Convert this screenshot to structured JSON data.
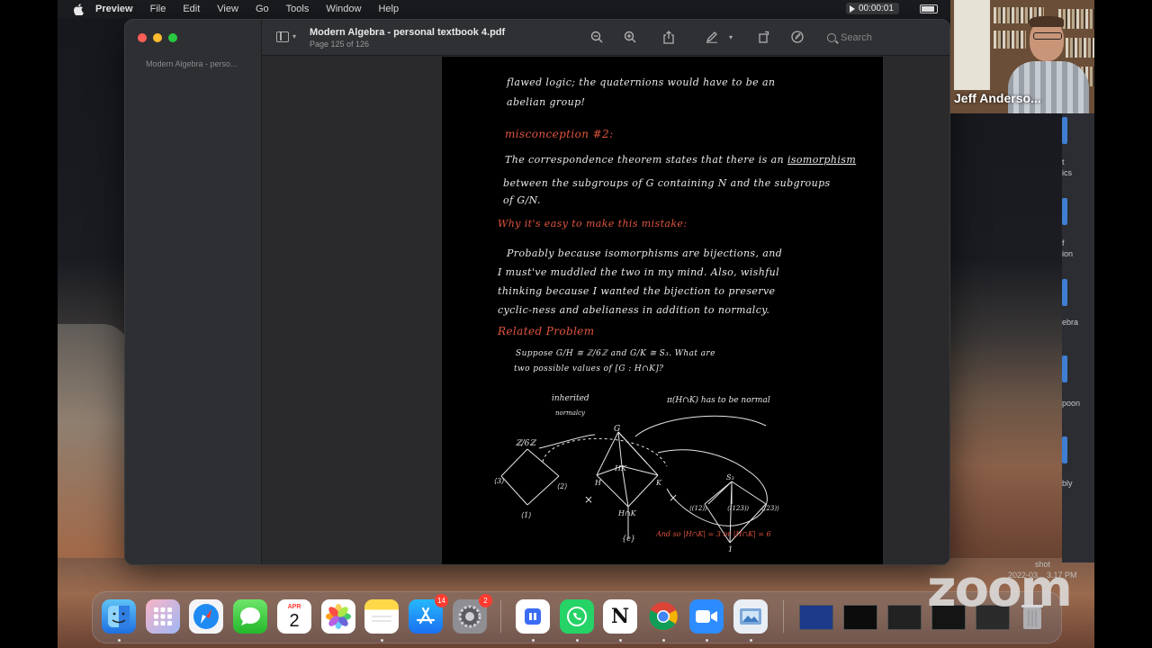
{
  "menubar": {
    "app": "Preview",
    "items": [
      "File",
      "Edit",
      "View",
      "Go",
      "Tools",
      "Window",
      "Help"
    ],
    "recording_time": "00:00:01"
  },
  "window": {
    "title": "Modern Algebra - personal textbook 4.pdf",
    "subtitle": "Page 125 of 126",
    "sidebar_thumb_title": "Modern Algebra - perso...",
    "search_placeholder": "Search"
  },
  "notes": {
    "line1": "flawed logic; the quaternions would have to be an",
    "line2": "abelian group!",
    "heading1": "misconception #2:",
    "p1a": "The correspondence theorem states that there is an",
    "p1b": "isomorphism",
    "p1c": "between the subgroups of G containing N and the subgroups",
    "p1d": "of G/N.",
    "heading2": "Why it's easy to make this mistake:",
    "p2a": "Probably because isomorphisms are bijections, and",
    "p2b": "I must've muddled the two in my mind. Also, wishful",
    "p2c": "thinking because I wanted the bijection to preserve",
    "p2d": "cyclic-ness and abelianess in addition to normalcy.",
    "heading3": "Related Problem",
    "prob1": "Suppose G/H ≅ ℤ/6ℤ and G/K ≅ S₃. What are",
    "prob2": "two possible values of [G : H∩K]?",
    "diagram": {
      "inherited": "inherited",
      "normalcy": "normalcy",
      "pi_note": "π(H∩K) has to be normal",
      "z6": "ℤ/6ℤ",
      "n3": "⟨3⟩",
      "n2": "⟨2⟩",
      "n1": "⟨1⟩",
      "g": "G",
      "h": "H",
      "k": "K",
      "hk": "HK",
      "hnk": "H∩K",
      "e": "{e}",
      "s3": "S₃",
      "s12": "⟨(12)⟩",
      "s123": "⟨(123)⟩",
      "s23": "⟨(23)⟩",
      "one": "1",
      "x": "×",
      "answer": "And so |H∩K| = 3 or |H∩K| = 6"
    }
  },
  "zoom": {
    "participant_name": "Jeff Anderso...",
    "logo": "zoom"
  },
  "dock": {
    "calendar_month": "APR",
    "calendar_day": "2",
    "appstore_badge": "14",
    "settings_badge": "2"
  },
  "background_window": {
    "rows": [
      "t",
      "ics",
      "f",
      "ion",
      "ebra",
      "poon",
      "bly"
    ],
    "screenshot_label": "shot",
    "screenshot_date": "2022-03... 3.17 PM"
  }
}
